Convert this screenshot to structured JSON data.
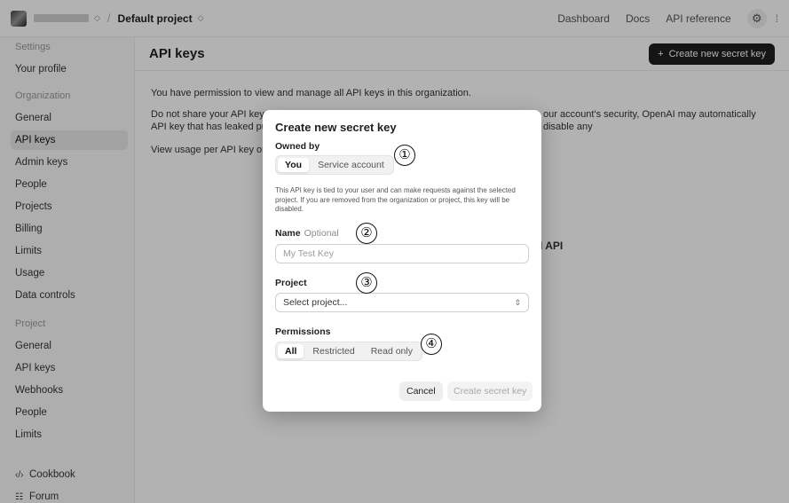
{
  "topbar": {
    "chevron": "◇",
    "separator": "/",
    "project": "Default project",
    "links": [
      "Dashboard",
      "Docs",
      "API reference"
    ],
    "gear_icon": "gear-icon"
  },
  "sidebar": {
    "items": [
      {
        "label": "Settings",
        "kind": "head"
      },
      {
        "label": "Your profile"
      },
      {
        "label": "Organization",
        "kind": "head"
      },
      {
        "label": "General"
      },
      {
        "label": "API keys",
        "active": true
      },
      {
        "label": "Admin keys"
      },
      {
        "label": "People"
      },
      {
        "label": "Projects"
      },
      {
        "label": "Billing"
      },
      {
        "label": "Limits"
      },
      {
        "label": "Usage"
      },
      {
        "label": "Data controls"
      },
      {
        "label": "Project",
        "kind": "head"
      },
      {
        "label": "General"
      },
      {
        "label": "API keys"
      },
      {
        "label": "Webhooks"
      },
      {
        "label": "People"
      },
      {
        "label": "Limits"
      },
      {
        "label": "Cookbook",
        "icon": "‹/›"
      },
      {
        "label": "Forum",
        "icon": "☷"
      }
    ]
  },
  "main": {
    "title": "API keys",
    "create_button": "Create new secret key",
    "create_plus": "+",
    "p1": "You have permission to view and manage all API keys in this organization.",
    "p2a": "Do not share your API key wit",
    "p2b": "our account's security, OpenAI may automatically disable any",
    "p2c": "API key that has leaked publi",
    "p3": "View usage per API key on the",
    "snippet": "I API"
  },
  "modal": {
    "title": "Create new secret key",
    "owned_by_label": "Owned by",
    "owned_options": [
      "You",
      "Service account"
    ],
    "owned_selected": 0,
    "note": "This API key is tied to your user and can make requests against the selected project. If you are removed from the organization or project, this key will be disabled.",
    "name_label": "Name",
    "name_optional": "Optional",
    "name_placeholder": "My Test Key",
    "project_label": "Project",
    "project_value": "Select project...",
    "project_chevron": "⇕",
    "permissions_label": "Permissions",
    "permission_options": [
      "All",
      "Restricted",
      "Read only"
    ],
    "permission_selected": 0,
    "cancel": "Cancel",
    "create": "Create secret key"
  },
  "callouts": [
    "①",
    "②",
    "③",
    "④"
  ]
}
